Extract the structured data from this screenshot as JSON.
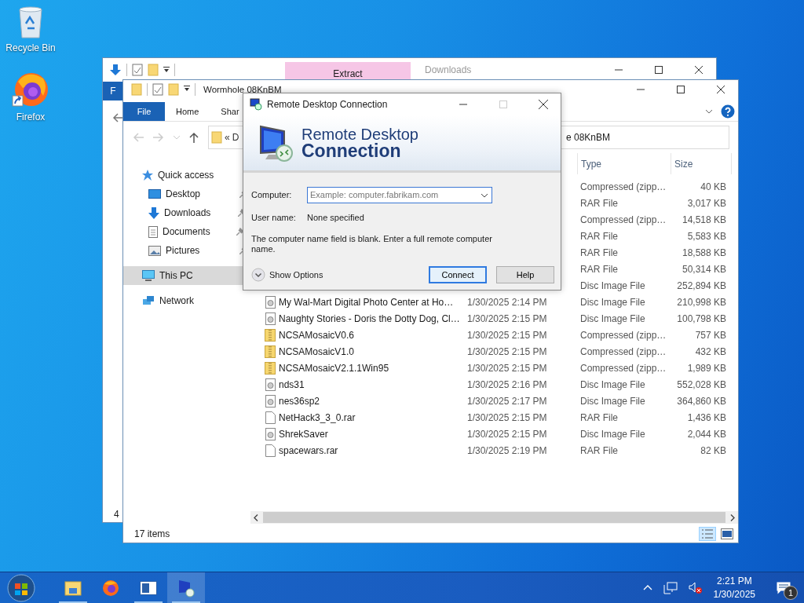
{
  "desktop_icons": [
    {
      "label": "Recycle Bin",
      "kind": "recycle"
    },
    {
      "label": "Firefox",
      "kind": "firefox"
    }
  ],
  "back_window": {
    "ribbon_tab": "Extract",
    "title": "Downloads",
    "file_tab": "F",
    "status": "4"
  },
  "explorer": {
    "title": "Wormhole 08KnBM",
    "ribbon_tabs": [
      {
        "label": "File",
        "kind": "menu"
      },
      {
        "label": "Home",
        "kind": "tab"
      },
      {
        "label": "Shar",
        "kind": "tab"
      }
    ],
    "address": {
      "chevron": "«",
      "start": "D",
      "end": "e 08KnBM"
    },
    "nav": [
      {
        "label": "Quick access",
        "kind": "star",
        "selected": false,
        "children": [
          {
            "label": "Desktop",
            "kind": "desktop",
            "pinned": true,
            "selected": false
          },
          {
            "label": "Downloads",
            "kind": "download",
            "pinned": true,
            "selected": false
          },
          {
            "label": "Documents",
            "kind": "document",
            "pinned": true,
            "selected": false
          },
          {
            "label": "Pictures",
            "kind": "pictures",
            "pinned": true,
            "selected": false
          }
        ]
      },
      {
        "label": "This PC",
        "kind": "pc",
        "selected": true
      },
      {
        "label": "Network",
        "kind": "network",
        "selected": false
      }
    ],
    "columns": [
      "Type",
      "Size"
    ],
    "rows": [
      {
        "type": "Compressed (zipp…",
        "size": "40 KB"
      },
      {
        "type": "RAR File",
        "size": "3,017 KB"
      },
      {
        "type": "Compressed (zipp…",
        "size": "14,518 KB"
      },
      {
        "type": "RAR File",
        "size": "5,583 KB"
      },
      {
        "type": "RAR File",
        "size": "18,588 KB"
      },
      {
        "type": "RAR File",
        "size": "50,314 KB"
      },
      {
        "type": "Disc Image File",
        "size": "252,894 KB"
      },
      {
        "kind": "disc",
        "name": "My Wal-Mart Digital Photo Center at Ho…",
        "date": "1/30/2025 2:14 PM",
        "type": "Disc Image File",
        "size": "210,998 KB"
      },
      {
        "kind": "disc",
        "name": "Naughty Stories - Doris the Dotty Dog, Cl…",
        "date": "1/30/2025 2:15 PM",
        "type": "Disc Image File",
        "size": "100,798 KB"
      },
      {
        "kind": "zip",
        "name": "NCSAMosaicV0.6",
        "date": "1/30/2025 2:15 PM",
        "type": "Compressed (zipp…",
        "size": "757 KB"
      },
      {
        "kind": "zip",
        "name": "NCSAMosaicV1.0",
        "date": "1/30/2025 2:15 PM",
        "type": "Compressed (zipp…",
        "size": "432 KB"
      },
      {
        "kind": "zip",
        "name": "NCSAMosaicV2.1.1Win95",
        "date": "1/30/2025 2:15 PM",
        "type": "Compressed (zipp…",
        "size": "1,989 KB"
      },
      {
        "kind": "disc",
        "name": "nds31",
        "date": "1/30/2025 2:16 PM",
        "type": "Disc Image File",
        "size": "552,028 KB"
      },
      {
        "kind": "disc",
        "name": "nes36sp2",
        "date": "1/30/2025 2:17 PM",
        "type": "Disc Image File",
        "size": "364,860 KB"
      },
      {
        "kind": "rar",
        "name": "NetHack3_3_0.rar",
        "date": "1/30/2025 2:15 PM",
        "type": "RAR File",
        "size": "1,436 KB"
      },
      {
        "kind": "disc",
        "name": "ShrekSaver",
        "date": "1/30/2025 2:15 PM",
        "type": "Disc Image File",
        "size": "2,044 KB"
      },
      {
        "kind": "rar",
        "name": "spacewars.rar",
        "date": "1/30/2025 2:19 PM",
        "type": "RAR File",
        "size": "82 KB"
      }
    ],
    "status": "17 items"
  },
  "dialog": {
    "title": "Remote Desktop Connection",
    "banner_line1": "Remote Desktop",
    "banner_line2": "Connection",
    "computer_label": "Computer:",
    "computer_placeholder": "Example: computer.fabrikam.com",
    "user_label": "User name:",
    "user_value": "None specified",
    "message": "The computer name field is blank. Enter a full remote computer name.",
    "show_options": "Show Options",
    "buttons": [
      {
        "label": "Connect",
        "default": true
      },
      {
        "label": "Help",
        "default": false
      }
    ]
  },
  "taskbar": {
    "apps": [
      {
        "kind": "explorer",
        "running": true,
        "selected": false
      },
      {
        "kind": "firefox",
        "running": false,
        "selected": false
      },
      {
        "kind": "window",
        "running": true,
        "selected": false
      },
      {
        "kind": "rdc",
        "running": true,
        "selected": true
      }
    ],
    "time": "2:21 PM",
    "date": "1/30/2025",
    "notifications": "1"
  }
}
